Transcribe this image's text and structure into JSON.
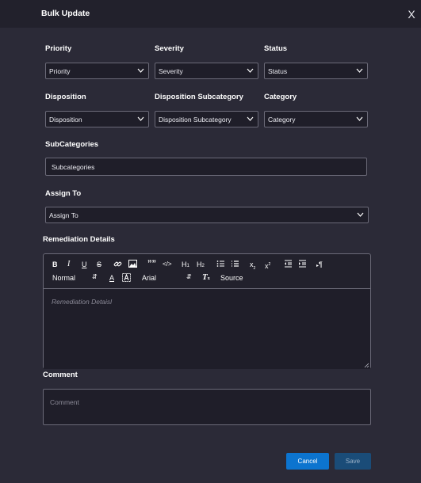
{
  "dialog": {
    "title": "Bulk Update",
    "close": "X"
  },
  "fields": {
    "priority": {
      "label": "Priority",
      "value": "Priority"
    },
    "severity": {
      "label": "Severity",
      "value": "Severity"
    },
    "status": {
      "label": "Status",
      "value": "Status"
    },
    "disposition": {
      "label": "Disposition",
      "value": "Disposition"
    },
    "disposition_subcategory": {
      "label": "Disposition Subcategory",
      "value": "Disposition Subcategory"
    },
    "category": {
      "label": "Category",
      "value": "Category"
    },
    "subcategories": {
      "label": "SubCategories",
      "value": "Subcategories"
    },
    "assign_to": {
      "label": "Assign To",
      "value": "Assign To"
    }
  },
  "remediation": {
    "label": "Remediation Details",
    "placeholder": "Remediation Detaisl",
    "toolbar": {
      "bold": "B",
      "italic": "I",
      "underline": "U",
      "strike": "S",
      "link": "link-icon",
      "image": "image-icon",
      "blockquote": "””",
      "code": "</>",
      "h1": "H",
      "h1_sub": "1",
      "h2": "H",
      "h2_sub": "2",
      "ordered_list": "ordered-list-icon",
      "bullet_list": "bullet-list-icon",
      "subscript": "x",
      "subscript_mark": "2",
      "superscript": "x",
      "superscript_mark": "2",
      "outdent": "outdent-icon",
      "indent": "indent-icon",
      "direction": "¶",
      "format": "Normal",
      "text_color": "A",
      "font": "Arial",
      "clear_format": "T",
      "source": "Source"
    }
  },
  "comment": {
    "label": "Comment",
    "placeholder": "Comment"
  },
  "actions": {
    "cancel": "Cancel",
    "save": "Save"
  },
  "colors": {
    "background": "#2b2a37",
    "header": "#22212c",
    "field": "#1f1e29",
    "border": "#6b6a78",
    "primary": "#0c74cf",
    "disabled": "#1a4c78"
  }
}
